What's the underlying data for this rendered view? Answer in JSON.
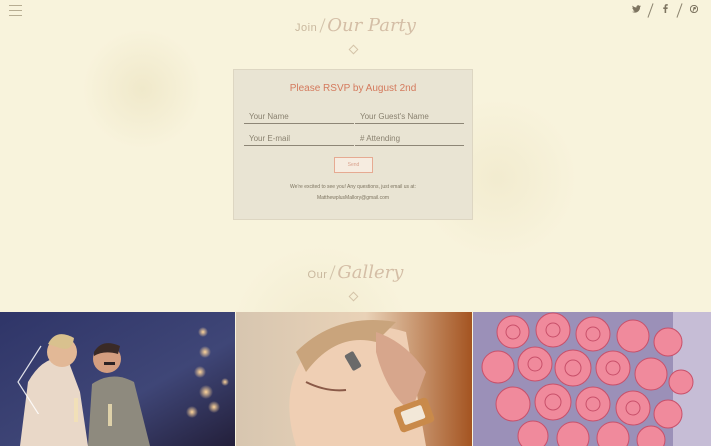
{
  "header": {
    "menu_icon": "hamburger-menu-icon",
    "social_icons": [
      "twitter-icon",
      "facebook-icon",
      "pinterest-icon"
    ]
  },
  "party_section": {
    "title_plain": "Join",
    "title_script": "Our Party"
  },
  "rsvp": {
    "heading": "Please RSVP by August 2nd",
    "name_placeholder": "Your Name",
    "guest_placeholder": "Your Guest's Name",
    "email_placeholder": "Your E-mail",
    "attending_placeholder": "# Attending",
    "send_label": "Send",
    "note_line1": "We're excited to see you! Any questions, just email us at:",
    "note_email": "MatthewplusMallory@gmail.com"
  },
  "gallery_section": {
    "title_plain": "Our",
    "title_script": "Gallery",
    "photos": [
      "couple-kissing-photo",
      "bride-closeup-photo",
      "pink-roses-bouquet-photo"
    ]
  },
  "colors": {
    "background": "#f8f3dc",
    "accent": "#d47a5d",
    "script_title": "#d4bea6"
  }
}
